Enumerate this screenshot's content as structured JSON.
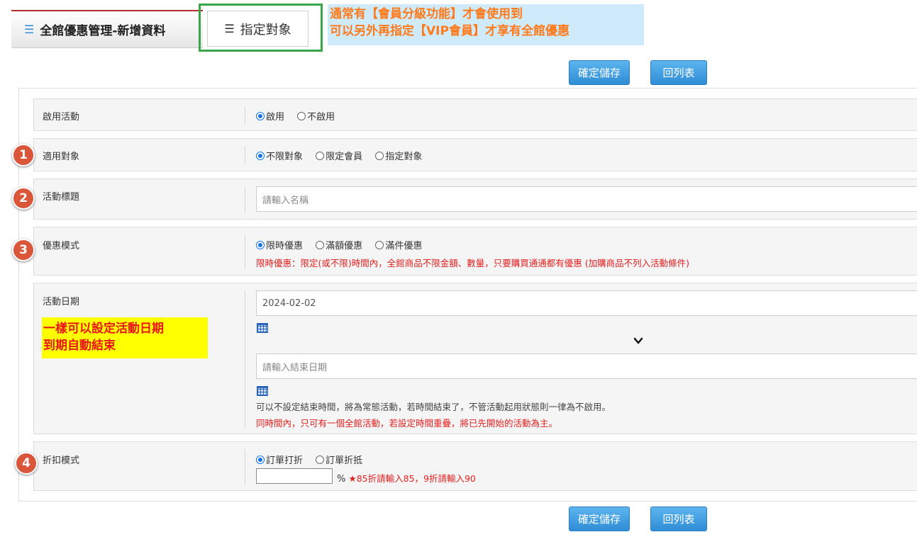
{
  "tabs": {
    "main": "全館優惠管理-新增資料",
    "target": "指定對象"
  },
  "notes": {
    "top_line1": "通常有【會員分級功能】才會使用到",
    "top_line2": "可以另外再指定【VIP會員】才享有全館優惠",
    "date_line1": "一樣可以設定活動日期",
    "date_line2": "到期自動結束"
  },
  "buttons": {
    "save": "確定儲存",
    "back": "回列表"
  },
  "markers": [
    "1",
    "2",
    "3",
    "4"
  ],
  "form": {
    "enable": {
      "label": "啟用活動",
      "options": [
        "啟用",
        "不啟用"
      ],
      "selected": 0
    },
    "audience": {
      "label": "適用對象",
      "options": [
        "不限對象",
        "限定會員",
        "指定對象"
      ],
      "selected": 0
    },
    "title": {
      "label": "活動標題",
      "placeholder": "請輸入名稱"
    },
    "mode": {
      "label": "優惠模式",
      "options": [
        "限時優惠",
        "滿額優惠",
        "滿件優惠"
      ],
      "selected": 0,
      "hint": "限時優惠：限定(或不限)時間內，全館商品不限金額、數量，只要購買通通都有優惠 (加購商品不列入活動條件)"
    },
    "date": {
      "label": "活動日期",
      "start_value": "2024-02-02",
      "end_placeholder": "請輸入結束日期",
      "hint_gray": "可以不設定結束時間，將為常態活動，若時間結束了，不管活動起用狀態則一律為不啟用。",
      "hint_red": "同時間內，只可有一個全館活動，若設定時間重疊，將已先開始的活動為主。"
    },
    "discount": {
      "label": "折扣模式",
      "options": [
        "訂單打折",
        "訂單折抵"
      ],
      "selected": 0,
      "unit": "%",
      "hint": "★85折請輸入85，9折請輸入90"
    }
  },
  "colors": {
    "accent_blue": "#2f8dd6",
    "marker_red": "#d9563a",
    "hint_red": "#e02020",
    "note_orange": "#ff7a1a",
    "highlight_green": "#3aa548"
  }
}
